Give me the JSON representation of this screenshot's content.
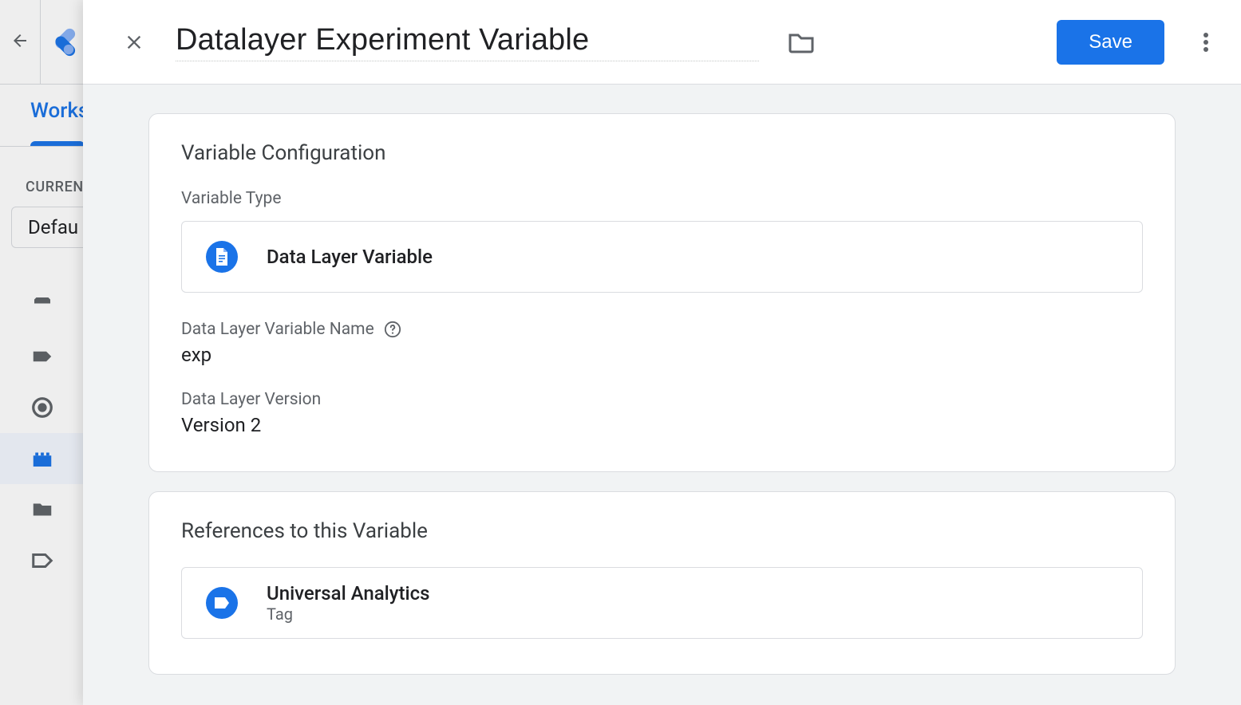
{
  "bg": {
    "tab_label": "Works",
    "section_label": "CURREN",
    "workspace_chip": "Defau"
  },
  "header": {
    "title": "Datalayer Experiment Variable",
    "save_label": "Save"
  },
  "config": {
    "card_title": "Variable Configuration",
    "type_label": "Variable Type",
    "type_name": "Data Layer Variable",
    "name_label": "Data Layer Variable Name",
    "name_value": "exp",
    "version_label": "Data Layer Version",
    "version_value": "Version 2"
  },
  "references": {
    "card_title": "References to this Variable",
    "items": [
      {
        "name": "Universal Analytics",
        "type": "Tag"
      }
    ]
  }
}
